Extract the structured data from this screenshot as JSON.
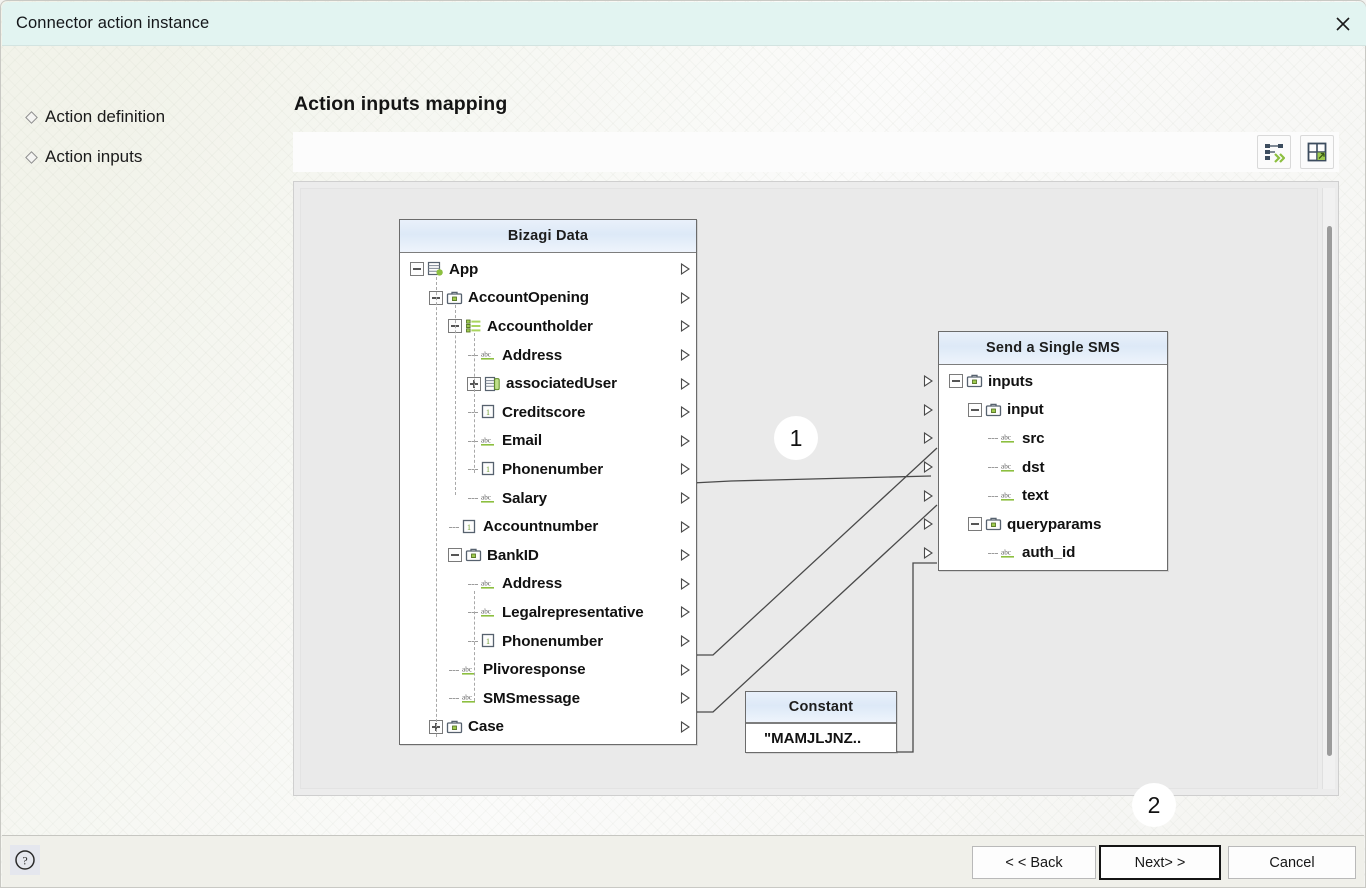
{
  "window": {
    "title": "Connector action instance",
    "close_icon": "close-icon"
  },
  "sidebar": {
    "items": [
      {
        "label": "Action definition"
      },
      {
        "label": "Action inputs"
      }
    ]
  },
  "main": {
    "heading": "Action inputs mapping"
  },
  "toolbar": {
    "buttons": [
      {
        "name": "auto-map-button",
        "title": "Auto map"
      },
      {
        "name": "fit-to-window-button",
        "title": "Fit to window"
      }
    ]
  },
  "canvas": {
    "source_node": {
      "title": "Bizagi Data",
      "rows": [
        {
          "label": "App",
          "indent": 0,
          "expander": "minus",
          "icon": "entity-green",
          "port": "right"
        },
        {
          "label": "AccountOpening",
          "indent": 1,
          "expander": "minus",
          "icon": "briefcase",
          "port": "right"
        },
        {
          "label": "Accountholder",
          "indent": 2,
          "expander": "minus",
          "icon": "collection",
          "port": "right"
        },
        {
          "label": "Address",
          "indent": 3,
          "expander": "none",
          "icon": "abc",
          "port": "right"
        },
        {
          "label": "associatedUser",
          "indent": 3,
          "expander": "plus",
          "icon": "entity-list",
          "port": "right"
        },
        {
          "label": "Creditscore",
          "indent": 3,
          "expander": "none",
          "icon": "number",
          "port": "right"
        },
        {
          "label": "Email",
          "indent": 3,
          "expander": "none",
          "icon": "abc",
          "port": "right"
        },
        {
          "label": "Phonenumber",
          "indent": 3,
          "expander": "none",
          "icon": "number",
          "port": "right"
        },
        {
          "label": "Salary",
          "indent": 3,
          "expander": "none",
          "icon": "abc",
          "port": "right"
        },
        {
          "label": "Accountnumber",
          "indent": 2,
          "expander": "none",
          "icon": "number",
          "port": "right"
        },
        {
          "label": "BankID",
          "indent": 2,
          "expander": "minus",
          "icon": "briefcase",
          "port": "right"
        },
        {
          "label": "Address",
          "indent": 3,
          "expander": "none",
          "icon": "abc",
          "port": "right"
        },
        {
          "label": "Legalrepresentative",
          "indent": 3,
          "expander": "none",
          "icon": "abc",
          "port": "right"
        },
        {
          "label": "Phonenumber",
          "indent": 3,
          "expander": "none",
          "icon": "number",
          "port": "right"
        },
        {
          "label": "Plivoresponse",
          "indent": 2,
          "expander": "none",
          "icon": "abc",
          "port": "right"
        },
        {
          "label": "SMSmessage",
          "indent": 2,
          "expander": "none",
          "icon": "abc",
          "port": "right"
        },
        {
          "label": "Case",
          "indent": 1,
          "expander": "plus",
          "icon": "briefcase",
          "port": "right"
        }
      ]
    },
    "target_node": {
      "title": "Send a Single SMS",
      "rows": [
        {
          "label": "inputs",
          "indent": 0,
          "expander": "minus",
          "icon": "briefcase",
          "port": "left"
        },
        {
          "label": "input",
          "indent": 1,
          "expander": "minus",
          "icon": "briefcase",
          "port": "left"
        },
        {
          "label": "src",
          "indent": 2,
          "expander": "none",
          "icon": "abc",
          "port": "left"
        },
        {
          "label": "dst",
          "indent": 2,
          "expander": "none",
          "icon": "abc",
          "port": "left"
        },
        {
          "label": "text",
          "indent": 2,
          "expander": "none",
          "icon": "abc",
          "port": "left"
        },
        {
          "label": "queryparams",
          "indent": 1,
          "expander": "minus",
          "icon": "briefcase",
          "port": "left"
        },
        {
          "label": "auth_id",
          "indent": 2,
          "expander": "none",
          "icon": "abc",
          "port": "left"
        }
      ]
    },
    "constant_node": {
      "title": "Constant",
      "value": "\"MAMJLJNZ.."
    },
    "connections": [
      {
        "from": "Accountholder.Phonenumber",
        "to": "dst"
      },
      {
        "from": "BankID.Phonenumber",
        "to": "src"
      },
      {
        "from": "SMSmessage",
        "to": "text"
      },
      {
        "from": "Constant",
        "to": "auth_id"
      }
    ],
    "scrollbar": {
      "name": "canvas-vertical-scrollbar"
    }
  },
  "callouts": [
    {
      "number": "1"
    },
    {
      "number": "2"
    }
  ],
  "footer": {
    "help_icon": "help-icon",
    "back_label": "< < Back",
    "next_label": "Next> >",
    "cancel_label": "Cancel"
  },
  "colors": {
    "titlebar": "#e2f4f1",
    "node_header": "#dde9f7",
    "accent_green": "#8cbf3f"
  }
}
